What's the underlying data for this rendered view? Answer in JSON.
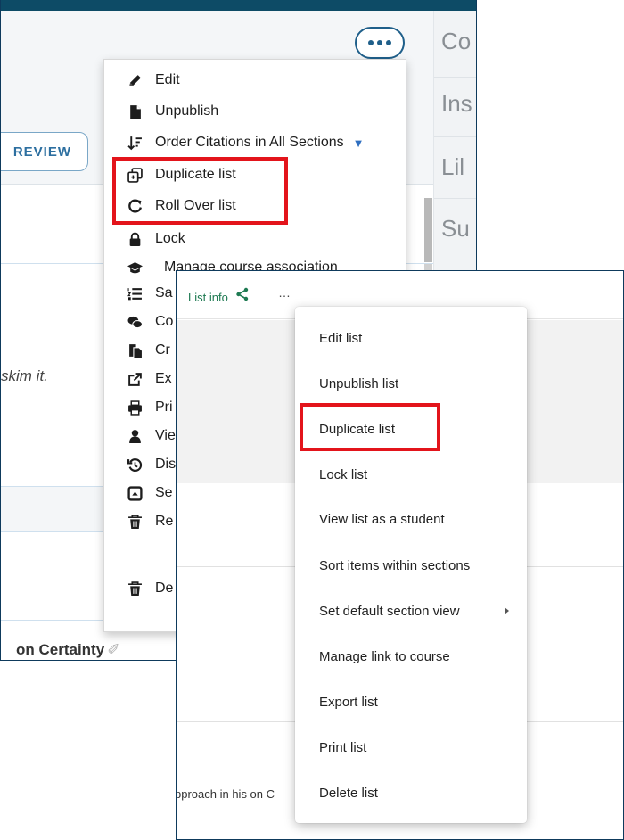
{
  "colors": {
    "highlight": "#e3141b",
    "accent_blue": "#1f5f8a",
    "accent_green": "#1e7a52",
    "frame": "#0e3a5c"
  },
  "back_screen": {
    "more_button_icon": "ellipsis-icon",
    "preview_button_label": "REVIEW",
    "skim_text": "skim it.",
    "certainty_text": "on Certainty",
    "right_pane": [
      "Co",
      "Ins",
      "Lil",
      "Su"
    ],
    "menu": [
      {
        "label": "Edit",
        "icon": "pencil-icon"
      },
      {
        "label": "Unpublish",
        "icon": "file-icon"
      },
      {
        "label": "Order Citations in All Sections",
        "icon": "sort-icon",
        "has_dropdown": true
      },
      {
        "label": "Duplicate list",
        "icon": "duplicate-icon",
        "highlighted": true
      },
      {
        "label": "Roll Over list",
        "icon": "rollover-icon",
        "highlighted": true
      },
      {
        "label": "Lock",
        "icon": "lock-icon"
      },
      {
        "label": "Manage course association",
        "icon": "graduation-cap-icon"
      },
      {
        "label": "Sa",
        "icon": "list-icon"
      },
      {
        "label": "Co",
        "icon": "comments-icon"
      },
      {
        "label": "Cr",
        "icon": "copy-icon"
      },
      {
        "label": "Ex",
        "icon": "external-link-icon"
      },
      {
        "label": "Pri",
        "icon": "print-icon"
      },
      {
        "label": "Vie",
        "icon": "user-icon"
      },
      {
        "label": "Dis",
        "icon": "history-icon"
      },
      {
        "label": "Se",
        "icon": "caret-square-icon"
      },
      {
        "label": "Re",
        "icon": "trash-icon"
      },
      {
        "label": "De",
        "icon": "trash-icon"
      }
    ]
  },
  "front_screen": {
    "tab_label": "List info",
    "share_icon": "share-icon",
    "more_label": "…",
    "footer_text": "pproach in his on C",
    "menu": [
      {
        "label": "Edit list"
      },
      {
        "label": "Unpublish list"
      },
      {
        "label": "Duplicate list",
        "highlighted": true
      },
      {
        "label": "Lock list"
      },
      {
        "label": "View list as a student"
      },
      {
        "label": "Sort items within sections"
      },
      {
        "label": "Set default section view",
        "has_submenu": true
      },
      {
        "label": "Manage link to course"
      },
      {
        "label": "Export list"
      },
      {
        "label": "Print list"
      },
      {
        "label": "Delete list"
      }
    ]
  }
}
